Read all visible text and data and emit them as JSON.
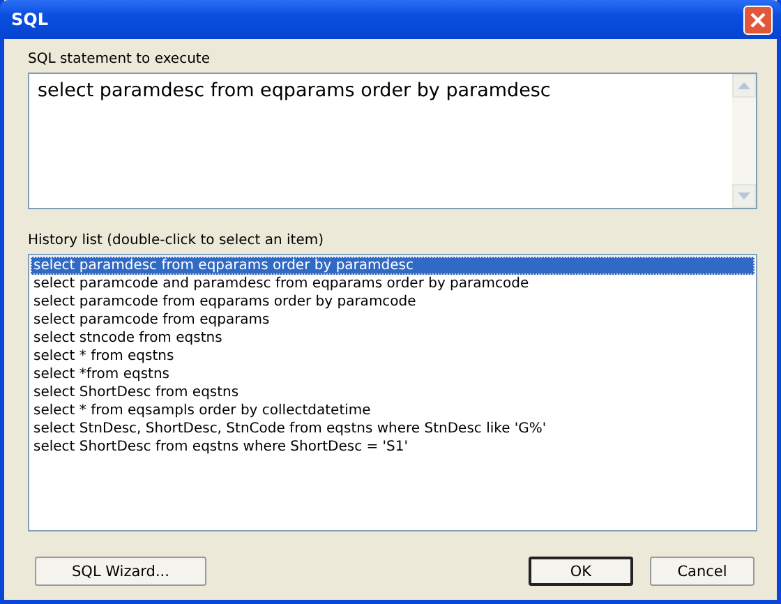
{
  "window": {
    "title": "SQL"
  },
  "statement": {
    "label": "SQL statement to execute",
    "value": "select paramdesc from eqparams order by paramdesc"
  },
  "history": {
    "label": "History list (double-click to select an item)",
    "items": [
      {
        "text": "select paramdesc from eqparams order by paramdesc",
        "selected": true
      },
      {
        "text": "select paramcode and paramdesc from eqparams order by paramcode",
        "selected": false
      },
      {
        "text": "select paramcode from eqparams order by paramcode",
        "selected": false
      },
      {
        "text": "select paramcode from eqparams",
        "selected": false
      },
      {
        "text": "select stncode from eqstns",
        "selected": false
      },
      {
        "text": "select * from eqstns",
        "selected": false
      },
      {
        "text": "select *from eqstns",
        "selected": false
      },
      {
        "text": "select ShortDesc from eqstns",
        "selected": false
      },
      {
        "text": "select * from eqsampls order by collectdatetime",
        "selected": false
      },
      {
        "text": "select StnDesc, ShortDesc, StnCode from eqstns where StnDesc like 'G%'",
        "selected": false
      },
      {
        "text": "select ShortDesc from eqstns where ShortDesc = 'S1'",
        "selected": false
      }
    ]
  },
  "buttons": {
    "wizard": "SQL Wizard...",
    "ok": "OK",
    "cancel": "Cancel"
  }
}
